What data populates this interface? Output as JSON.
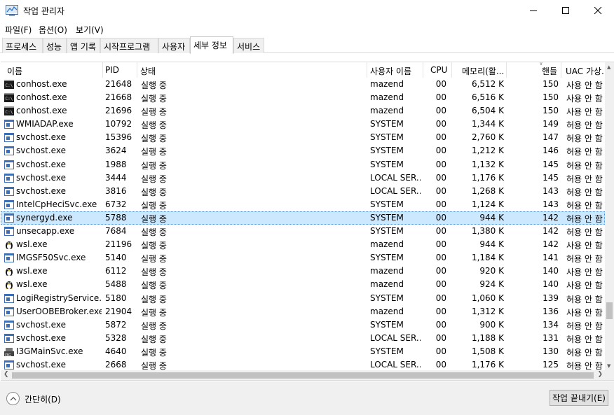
{
  "window": {
    "title": "작업 관리자"
  },
  "menu": [
    "파일(F)",
    "옵션(O)",
    "보기(V)"
  ],
  "tabs": [
    "프로세스",
    "성능",
    "앱 기록",
    "시작프로그램",
    "사용자",
    "세부 정보",
    "서비스"
  ],
  "active_tab": "세부 정보",
  "columns": {
    "name": "이름",
    "pid": "PID",
    "status": "상태",
    "user": "사용자 이름",
    "cpu": "CPU",
    "memory": "메모리(활...",
    "handles": "핸들",
    "uac": "UAC 가상..."
  },
  "rows": [
    {
      "icon": "console",
      "name": "conhost.exe",
      "pid": "21648",
      "status": "실행 중",
      "user": "mazend",
      "cpu": "00",
      "mem": "6,512 K",
      "handles": "150",
      "uac": "사용 안 함"
    },
    {
      "icon": "console",
      "name": "conhost.exe",
      "pid": "21668",
      "status": "실행 중",
      "user": "mazend",
      "cpu": "00",
      "mem": "6,516 K",
      "handles": "150",
      "uac": "사용 안 함"
    },
    {
      "icon": "console",
      "name": "conhost.exe",
      "pid": "21696",
      "status": "실행 중",
      "user": "mazend",
      "cpu": "00",
      "mem": "6,504 K",
      "handles": "150",
      "uac": "사용 안 함"
    },
    {
      "icon": "service",
      "name": "WMIADAP.exe",
      "pid": "10792",
      "status": "실행 중",
      "user": "SYSTEM",
      "cpu": "00",
      "mem": "1,344 K",
      "handles": "149",
      "uac": "허용 안 함"
    },
    {
      "icon": "service",
      "name": "svchost.exe",
      "pid": "15396",
      "status": "실행 중",
      "user": "SYSTEM",
      "cpu": "00",
      "mem": "2,760 K",
      "handles": "147",
      "uac": "허용 안 함"
    },
    {
      "icon": "service",
      "name": "svchost.exe",
      "pid": "3624",
      "status": "실행 중",
      "user": "SYSTEM",
      "cpu": "00",
      "mem": "1,212 K",
      "handles": "146",
      "uac": "허용 안 함"
    },
    {
      "icon": "service",
      "name": "svchost.exe",
      "pid": "1988",
      "status": "실행 중",
      "user": "SYSTEM",
      "cpu": "00",
      "mem": "1,132 K",
      "handles": "145",
      "uac": "허용 안 함"
    },
    {
      "icon": "service",
      "name": "svchost.exe",
      "pid": "3444",
      "status": "실행 중",
      "user": "LOCAL SER...",
      "cpu": "00",
      "mem": "1,176 K",
      "handles": "145",
      "uac": "허용 안 함"
    },
    {
      "icon": "service",
      "name": "svchost.exe",
      "pid": "3816",
      "status": "실행 중",
      "user": "LOCAL SER...",
      "cpu": "00",
      "mem": "1,268 K",
      "handles": "143",
      "uac": "허용 안 함"
    },
    {
      "icon": "service",
      "name": "IntelCpHeciSvc.exe",
      "pid": "6732",
      "status": "실행 중",
      "user": "SYSTEM",
      "cpu": "00",
      "mem": "1,124 K",
      "handles": "143",
      "uac": "허용 안 함"
    },
    {
      "icon": "service",
      "name": "synergyd.exe",
      "pid": "5788",
      "status": "실행 중",
      "user": "SYSTEM",
      "cpu": "00",
      "mem": "944 K",
      "handles": "142",
      "uac": "허용 안 함",
      "selected": true
    },
    {
      "icon": "service",
      "name": "unsecapp.exe",
      "pid": "7684",
      "status": "실행 중",
      "user": "SYSTEM",
      "cpu": "00",
      "mem": "1,380 K",
      "handles": "142",
      "uac": "허용 안 함"
    },
    {
      "icon": "penguin",
      "name": "wsl.exe",
      "pid": "21196",
      "status": "실행 중",
      "user": "mazend",
      "cpu": "00",
      "mem": "944 K",
      "handles": "142",
      "uac": "사용 안 함"
    },
    {
      "icon": "service",
      "name": "IMGSF50Svc.exe",
      "pid": "5140",
      "status": "실행 중",
      "user": "SYSTEM",
      "cpu": "00",
      "mem": "1,184 K",
      "handles": "141",
      "uac": "허용 안 함"
    },
    {
      "icon": "penguin",
      "name": "wsl.exe",
      "pid": "6112",
      "status": "실행 중",
      "user": "mazend",
      "cpu": "00",
      "mem": "920 K",
      "handles": "140",
      "uac": "사용 안 함"
    },
    {
      "icon": "penguin",
      "name": "wsl.exe",
      "pid": "5488",
      "status": "실행 중",
      "user": "mazend",
      "cpu": "00",
      "mem": "924 K",
      "handles": "140",
      "uac": "사용 안 함"
    },
    {
      "icon": "service",
      "name": "LogiRegistryService.e...",
      "pid": "5180",
      "status": "실행 중",
      "user": "SYSTEM",
      "cpu": "00",
      "mem": "1,060 K",
      "handles": "139",
      "uac": "허용 안 함"
    },
    {
      "icon": "service",
      "name": "UserOOBEBroker.exe",
      "pid": "21904",
      "status": "실행 중",
      "user": "mazend",
      "cpu": "00",
      "mem": "1,312 K",
      "handles": "136",
      "uac": "사용 안 함"
    },
    {
      "icon": "service",
      "name": "svchost.exe",
      "pid": "5872",
      "status": "실행 중",
      "user": "SYSTEM",
      "cpu": "00",
      "mem": "900 K",
      "handles": "134",
      "uac": "허용 안 함"
    },
    {
      "icon": "service",
      "name": "svchost.exe",
      "pid": "5328",
      "status": "실행 중",
      "user": "LOCAL SER...",
      "cpu": "00",
      "mem": "1,188 K",
      "handles": "131",
      "uac": "허용 안 함"
    },
    {
      "icon": "i3g",
      "name": "I3GMainSvc.exe",
      "pid": "4640",
      "status": "실행 중",
      "user": "SYSTEM",
      "cpu": "00",
      "mem": "1,508 K",
      "handles": "130",
      "uac": "허용 안 함"
    },
    {
      "icon": "service",
      "name": "svchost.exe",
      "pid": "2668",
      "status": "실행 중",
      "user": "LOCAL SER...",
      "cpu": "00",
      "mem": "1,176 K",
      "handles": "125",
      "uac": "허용 안 함"
    }
  ],
  "footer": {
    "collapse_label": "간단히(D)",
    "end_task_label": "작업 끝내기(E)"
  },
  "colors": {
    "selected_row": "#cce8ff",
    "footer_bg": "#f0f0f0"
  }
}
